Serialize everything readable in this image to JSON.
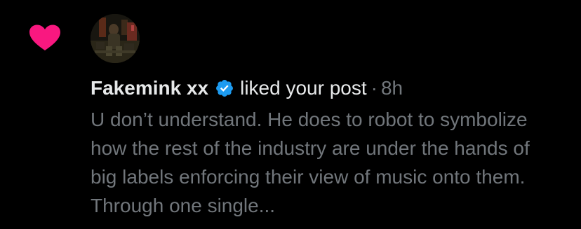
{
  "notification": {
    "type_icon": "heart-icon",
    "user_name": "Fakemink xx",
    "verified_icon": "verified-badge-icon",
    "action": "liked your post",
    "separator": "·",
    "time_ago": "8h",
    "post_text": "U don’t understand. He does to robot to symbolize how the rest of the industry are under the hands of big labels enforcing their view of music onto them. Through one single..."
  },
  "colors": {
    "background": "#000000",
    "heart": "#f91880",
    "verified": "#1d9bf0",
    "primary_text": "#e7e9ea",
    "secondary_text": "#71767b"
  }
}
